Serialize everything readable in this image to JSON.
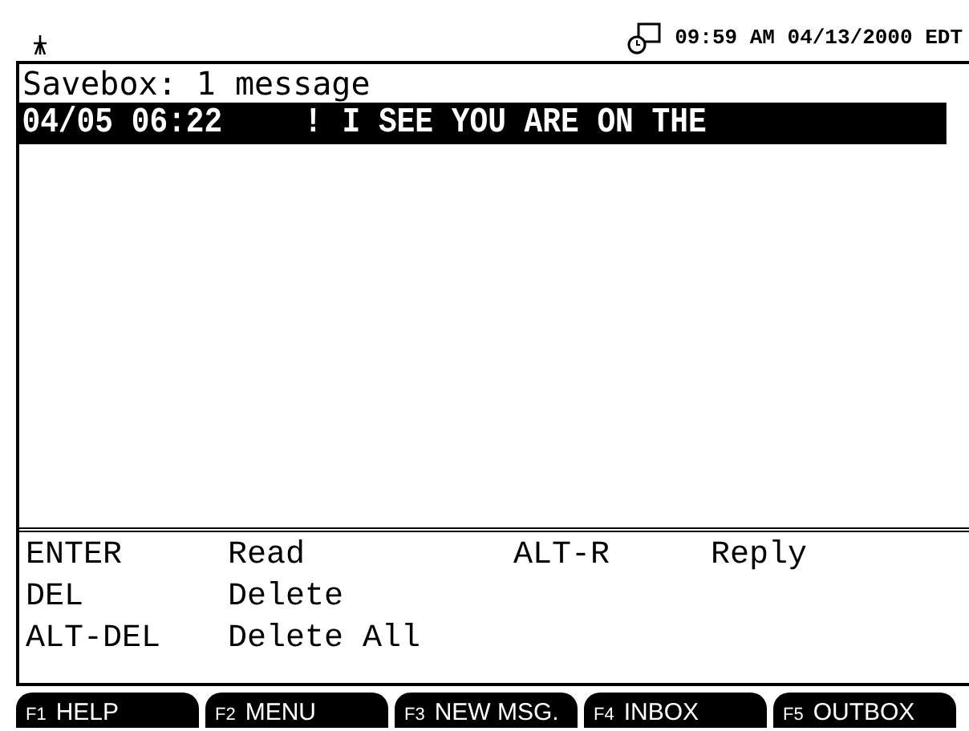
{
  "status_bar": {
    "datetime": "09:59 AM 04/13/2000 EDT"
  },
  "title": "Savebox: 1 message",
  "messages": [
    {
      "date": "04/05 06:22",
      "flag": "!",
      "subject": "I SEE YOU ARE ON THE",
      "selected": true
    }
  ],
  "help_rows": [
    {
      "keys": [
        {
          "key": "ENTER",
          "action": "Read"
        },
        {
          "key": "ALT-R",
          "action": "Reply"
        }
      ]
    },
    {
      "keys": [
        {
          "key": "DEL",
          "action": "Delete"
        }
      ]
    },
    {
      "keys": [
        {
          "key": "ALT-DEL",
          "action": "Delete All"
        }
      ]
    }
  ],
  "function_keys": [
    {
      "key": "F1",
      "label": "HELP"
    },
    {
      "key": "F2",
      "label": "MENU"
    },
    {
      "key": "F3",
      "label": "NEW MSG."
    },
    {
      "key": "F4",
      "label": "INBOX"
    },
    {
      "key": "F5",
      "label": "OUTBOX"
    }
  ]
}
